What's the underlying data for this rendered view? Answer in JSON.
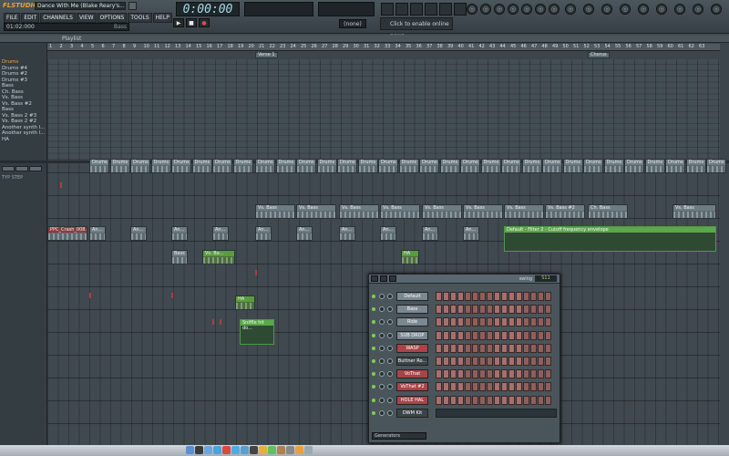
{
  "app": {
    "logo": "FLSTUDIO",
    "song_title": "Dance With Me (Blake Reary's...",
    "menu": [
      "FILE",
      "EDIT",
      "CHANNELS",
      "VIEW",
      "OPTIONS",
      "TOOLS",
      "HELP"
    ],
    "hint_left": "01:02:000",
    "hint_right": "Bass",
    "time": "0:00:00",
    "mode": "(none)",
    "news": "Click to enable online news",
    "transport": [
      "▶",
      "■",
      "●"
    ]
  },
  "playlist": {
    "title": "Playlist",
    "ruler_ticks": [
      "1",
      "2",
      "3",
      "4",
      "5",
      "6",
      "7",
      "8",
      "9",
      "10",
      "11",
      "12",
      "13",
      "14",
      "15",
      "16",
      "17",
      "18",
      "19",
      "20",
      "21",
      "22",
      "23",
      "24",
      "25",
      "26",
      "27",
      "28",
      "29",
      "30",
      "31",
      "32",
      "33",
      "34",
      "35",
      "36",
      "37",
      "38",
      "39",
      "40",
      "41",
      "42",
      "43",
      "44",
      "45",
      "46",
      "47",
      "48",
      "49",
      "50",
      "51",
      "52",
      "53",
      "54",
      "55",
      "56",
      "57",
      "58",
      "59",
      "60",
      "61",
      "62",
      "63"
    ],
    "markers": [
      "Verse 1",
      "Chorus"
    ],
    "patterns": [
      "Drums",
      "Drums #4",
      "Drums #2",
      "Drums #3",
      "Bass",
      "Ch. Bass",
      "Vs. Bass",
      "Vs. Bass #2",
      "Bass",
      "Vs. Bass 2 #3",
      "Vs. Bass 2 #2",
      "Another synth l...",
      "Another synth l...",
      "HA"
    ],
    "track_tools": [
      "TYP",
      "STEP"
    ],
    "clips": {
      "drums": "Drums",
      "vs_bass": "Vs. Bass",
      "vs_bass2": "Vs. Bass #2",
      "ch_bass": "Ch. Bass",
      "ppc": "PPC_Crash_008...",
      "an": "An...",
      "bass": "Bass",
      "vs_ba": "Vs. Ba...",
      "ha": "HA",
      "envelope": "Default - Filter 2 - Cutoff frequency envelope",
      "snffle": "Sniffle hit do..."
    }
  },
  "stepseq": {
    "swing_label": "swing",
    "pattern": "S11",
    "channels": [
      "Default",
      "Bass",
      "Ride",
      "SUB DROP",
      "WASP",
      "Buttner Ro...",
      "VoThat",
      "VoThat #2",
      "HOLE HAL",
      "DWM Kit"
    ],
    "footer": "Generators"
  },
  "colors": {
    "accent": "#e9a23a",
    "envelope": "#5aa848",
    "step": "#a6706c"
  },
  "dock_icons": [
    "finder-icon",
    "dashboard-icon",
    "mail-icon",
    "safari-icon",
    "ical-icon",
    "itunes-icon",
    "iphoto-icon",
    "imovie-icon",
    "garageband-icon",
    "ichat-icon",
    "address-book-icon",
    "preferences-icon",
    "fl-studio-icon",
    "trash-icon"
  ]
}
